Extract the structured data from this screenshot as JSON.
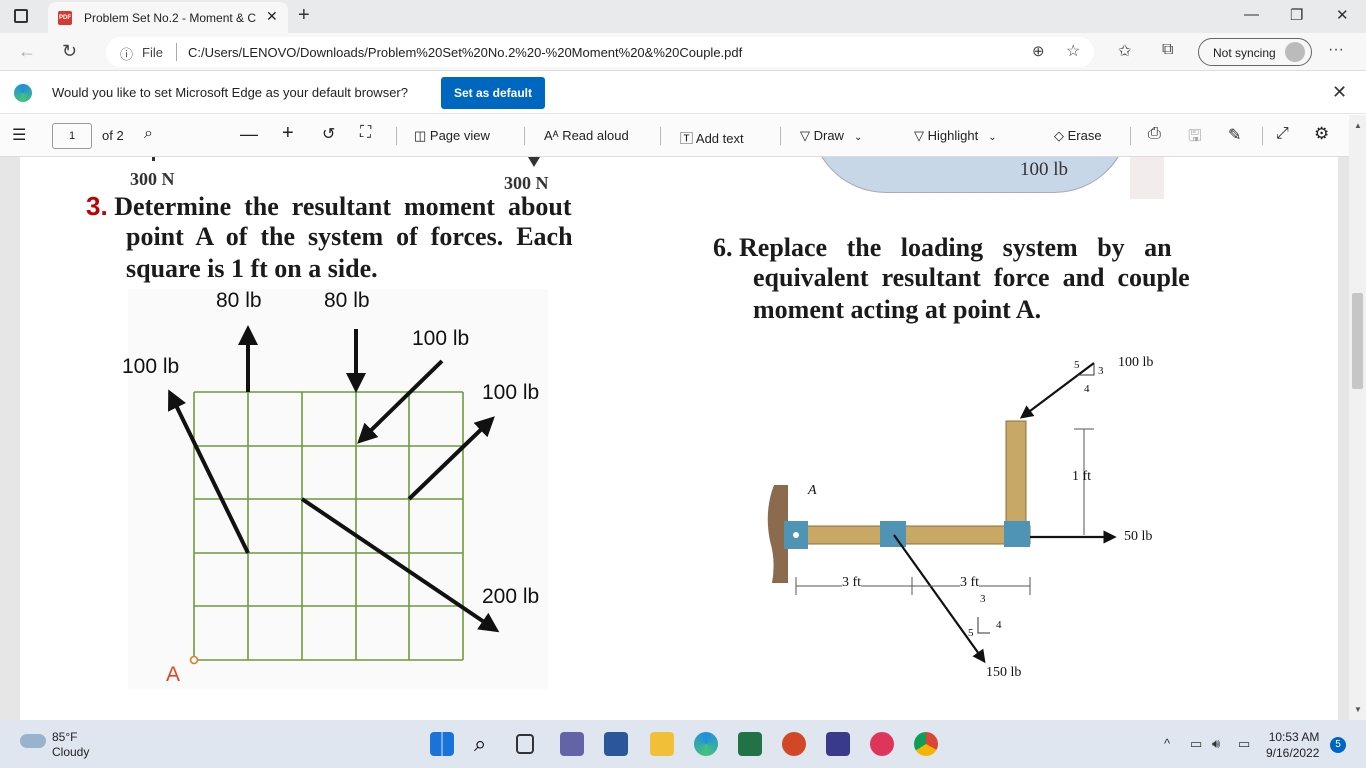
{
  "browser": {
    "tab_title": "Problem Set No.2 - Moment & C",
    "tab_icon": "PDF",
    "file_label": "File",
    "url": "C:/Users/LENOVO/Downloads/Problem%20Set%20No.2%20-%20Moment%20&%20Couple.pdf",
    "sync_label": "Not syncing"
  },
  "infobar": {
    "message": "Would you like to set Microsoft Edge as your default browser?",
    "button_label": "Set as default"
  },
  "pdf_toolbar": {
    "page_current": "1",
    "page_total": "of 2",
    "page_view": "Page view",
    "read_aloud": "Read aloud",
    "add_text": "Add text",
    "draw": "Draw",
    "highlight": "Highlight",
    "erase": "Erase"
  },
  "document": {
    "top_labels": {
      "left1": "300 N",
      "left2": "300 N",
      "right": "100 lb"
    },
    "problem3": {
      "number": "3.",
      "line1": "Determine  the  resultant  moment  about",
      "line2": "point  A  of  the  system  of  forces.  Each",
      "line3": "square is 1 ft on a side.",
      "labels": {
        "f80a": "80 lb",
        "f80b": "80 lb",
        "f100diag": "100 lb",
        "f100left": "100 lb",
        "f100right": "100 lb",
        "f200": "200 lb",
        "point": "A"
      }
    },
    "problem6": {
      "number": "6.",
      "line1": "Replace   the   loading   system   by   an",
      "line2": "equivalent  resultant  force  and  couple",
      "line3": "moment acting at point A.",
      "labels": {
        "f100": "100 lb",
        "f50": "50 lb",
        "f150": "150 lb",
        "point": "A",
        "d1ft": "1 ft",
        "d3ft_a": "3 ft",
        "d3ft_b": "3 ft",
        "s5a": "5",
        "s3a": "3",
        "s4a": "4",
        "s3b": "3",
        "s5b": "5",
        "s4b": "4"
      }
    }
  },
  "taskbar": {
    "temp": "85°F",
    "condition": "Cloudy",
    "time": "10:53 AM",
    "date": "9/16/2022",
    "notif_count": "5"
  }
}
